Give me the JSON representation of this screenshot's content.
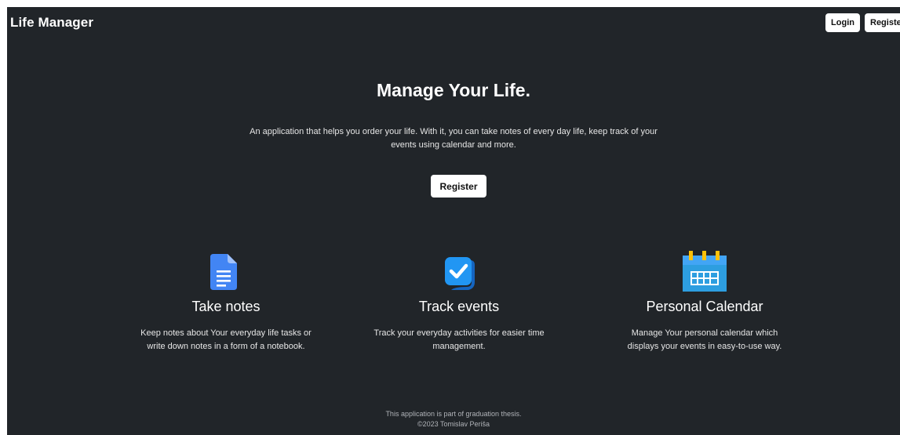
{
  "navbar": {
    "brand": "Life Manager",
    "login_label": "Login",
    "register_label": "Register"
  },
  "hero": {
    "title": "Manage Your Life.",
    "description_line1": "An application that helps you order your life. With it, you can take notes of every day life, keep track of your",
    "description_line2": "events using calendar and more.",
    "register_label": "Register"
  },
  "features": [
    {
      "icon": "document-icon",
      "title": "Take notes",
      "desc_line1": "Keep notes about Your everyday life tasks or",
      "desc_line2": "write down notes in a form of a notebook."
    },
    {
      "icon": "checkbox-icon",
      "title": "Track events",
      "desc_line1": "Track your everyday activities for easier time",
      "desc_line2": "management."
    },
    {
      "icon": "calendar-icon",
      "title": "Personal Calendar",
      "desc_line1": "Manage Your personal calendar which",
      "desc_line2": "displays your events in easy-to-use way."
    }
  ],
  "footer": {
    "line1": "This application is part of graduation thesis.",
    "line2": "©2023 Tomislav Periša"
  },
  "colors": {
    "background": "#212529",
    "button_bg": "#ffffff",
    "doc_icon_blue": "#4285f4",
    "check_icon_blue": "#2196f3",
    "calendar_icon_blue": "#2d9ee0",
    "calendar_icon_yellow": "#ffc107"
  }
}
